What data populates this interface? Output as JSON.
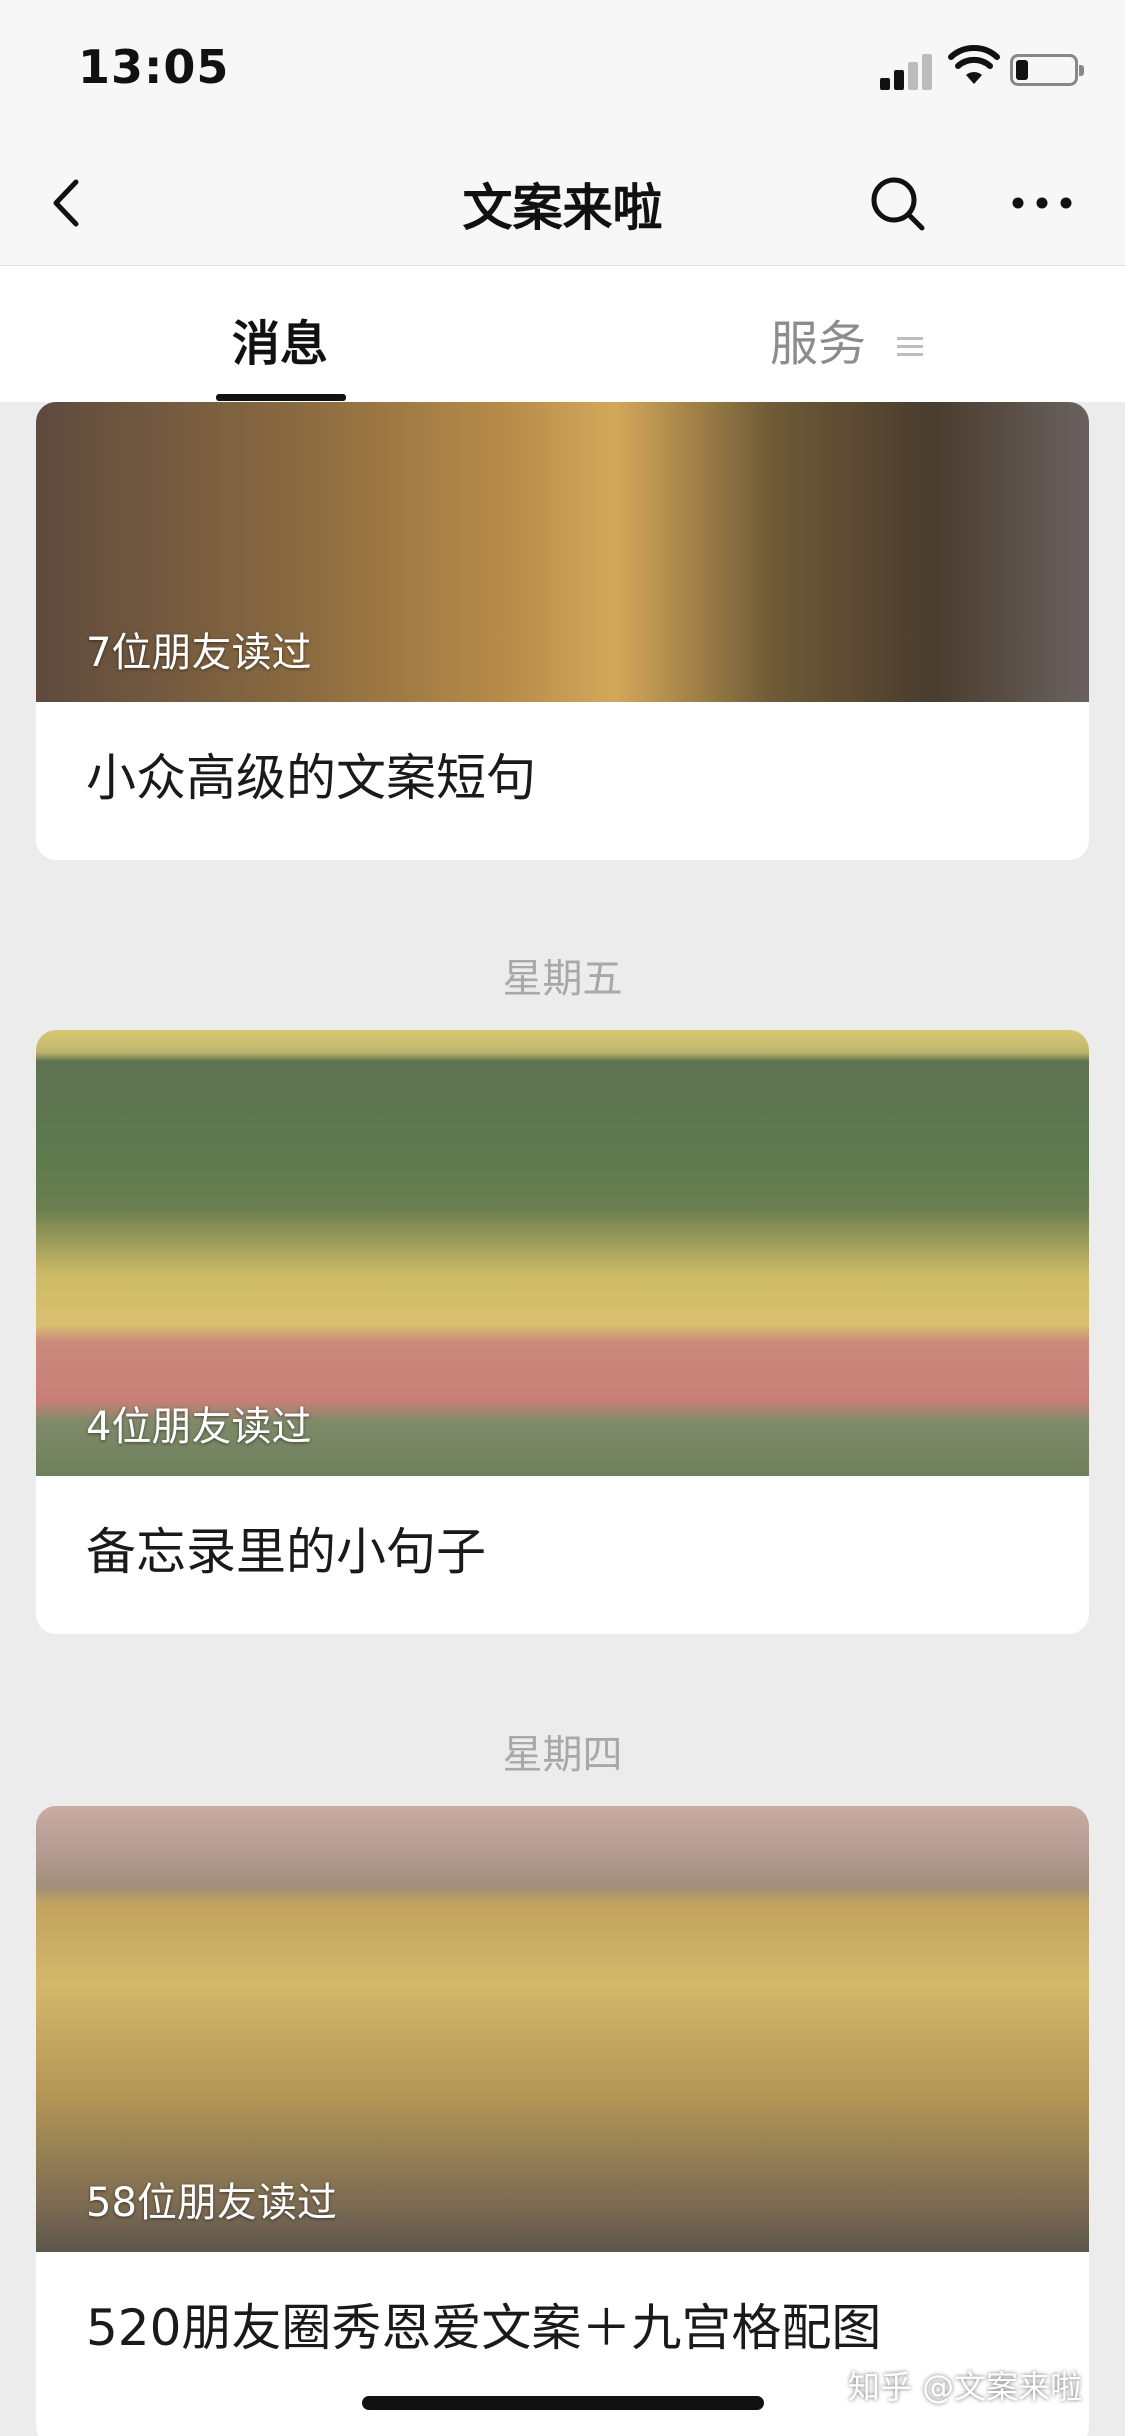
{
  "status_bar": {
    "time": "13:05",
    "battery_level": 0.2
  },
  "nav": {
    "title": "文案来啦",
    "back_icon": "chevron-left-icon",
    "search_icon": "search-icon",
    "more_icon": "more-horizontal-icon"
  },
  "tabs": [
    {
      "label": "消息",
      "active": true
    },
    {
      "label": "服务",
      "active": false,
      "icon": "menu-icon"
    }
  ],
  "feed": [
    {
      "read_count": "7位朋友读过",
      "title": "小众高级的文案短句"
    },
    {
      "date": "星期五",
      "read_count": "4位朋友读过",
      "title": "备忘录里的小句子"
    },
    {
      "date": "星期四",
      "read_count": "58位朋友读过",
      "title": "520朋友圈秀恩爱文案＋九宫格配图"
    }
  ],
  "watermark": "知乎 @文案来啦",
  "colors": {
    "background": "#ececec",
    "card": "#ffffff",
    "date_text": "#a8a8a8",
    "inactive_tab": "#8c8c8c"
  }
}
